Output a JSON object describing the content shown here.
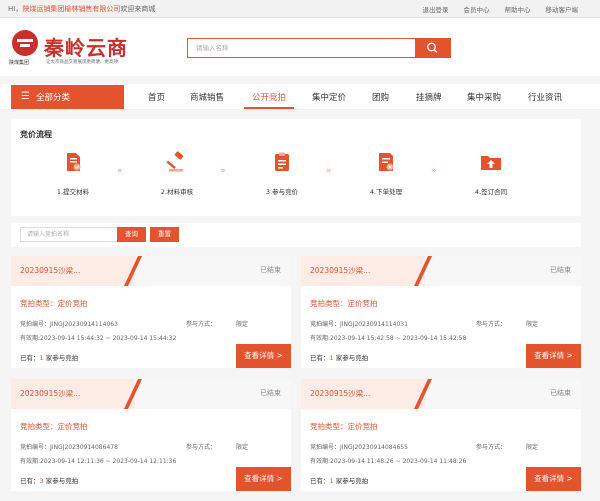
{
  "topbar": {
    "greeting_prefix": "HI，",
    "company": "陕煤运销集团榆林销售有限公司",
    "greeting_suffix": "欢迎来商城",
    "links": [
      "退出登录",
      "会员中心",
      "帮助中心",
      "移动客户端"
    ]
  },
  "header": {
    "brand": "秦岭云商",
    "logo_text": "陕煤集团",
    "slogan": "让大宗商品交易展现更简便、更高效",
    "search_placeholder": "请输入名称",
    "search_icon": "search-icon"
  },
  "nav": {
    "all_label": "全部分类",
    "menu_icon": "menu-icon",
    "items": [
      "首页",
      "商城销售",
      "公开竞拍",
      "集中定价",
      "团购",
      "挂摘牌",
      "集中采购",
      "行业资讯"
    ],
    "active": "公开竞拍"
  },
  "flow": {
    "title": "竞价流程",
    "steps": [
      {
        "label": "1.提交材料",
        "icon": "submit-document-icon"
      },
      {
        "label": "2.材料审核",
        "icon": "gavel-icon"
      },
      {
        "label": "3.参与竞价",
        "icon": "clipboard-icon"
      },
      {
        "label": "4.下单处理",
        "icon": "order-icon"
      },
      {
        "label": "4.签订合同",
        "icon": "upload-folder-icon"
      }
    ],
    "separator": "»"
  },
  "filter": {
    "placeholder": "请输入竞拍名称",
    "query_label": "查询",
    "reset_label": "重置"
  },
  "colors": {
    "accent": "#e2532e",
    "tag_bg": "#fdece6"
  },
  "cards": [
    {
      "title": "20230915沙梁...",
      "status": "已结束",
      "type_label": "竞拍类型：",
      "type": "定价竞拍",
      "no": "竞拍编号：JINGJ20230914114063",
      "mode_label": "参与方式：",
      "mode": "限定",
      "valid": "有效期:2023-09-14 15:44:32 ~ 2023-09-14 15:44:32",
      "count_prefix": "已有：",
      "count": "1",
      "count_suffix": " 家参与竞拍",
      "button": "查看详情 >"
    },
    {
      "title": "20230915沙梁...",
      "status": "已结束",
      "type_label": "竞拍类型：",
      "type": "定价竞拍",
      "no": "竞拍编号：JINGJ20230914114031",
      "mode_label": "参与方式：",
      "mode": "限定",
      "valid": "有效期:2023-09-14 15:42:58 ~ 2023-09-14 15:42:58",
      "count_prefix": "已有：",
      "count": "1",
      "count_suffix": " 家参与竞拍",
      "button": "查看详情 >"
    },
    {
      "title": "20230915沙梁...",
      "status": "已结束",
      "type_label": "竞拍类型：",
      "type": "定价竞拍",
      "no": "竞拍编号：JINGJ20230914086478",
      "mode_label": "参与方式：",
      "mode": "限定",
      "valid": "有效期:2023-09-14 12:11:36 ~ 2023-09-14 12:11:36",
      "count_prefix": "已有：",
      "count": "3",
      "count_suffix": " 家参与竞拍",
      "button": "查看详情 >"
    },
    {
      "title": "20230915沙梁...",
      "status": "已结束",
      "type_label": "竞拍类型：",
      "type": "定价竞拍",
      "no": "竞拍编号：JINGJ20230914084655",
      "mode_label": "参与方式：",
      "mode": "限定",
      "valid": "有效期:2023-09-14 11:48:26 ~ 2023-09-14 11:48:26",
      "count_prefix": "已有：",
      "count": "1",
      "count_suffix": " 家参与竞拍",
      "button": "查看详情 >"
    }
  ]
}
